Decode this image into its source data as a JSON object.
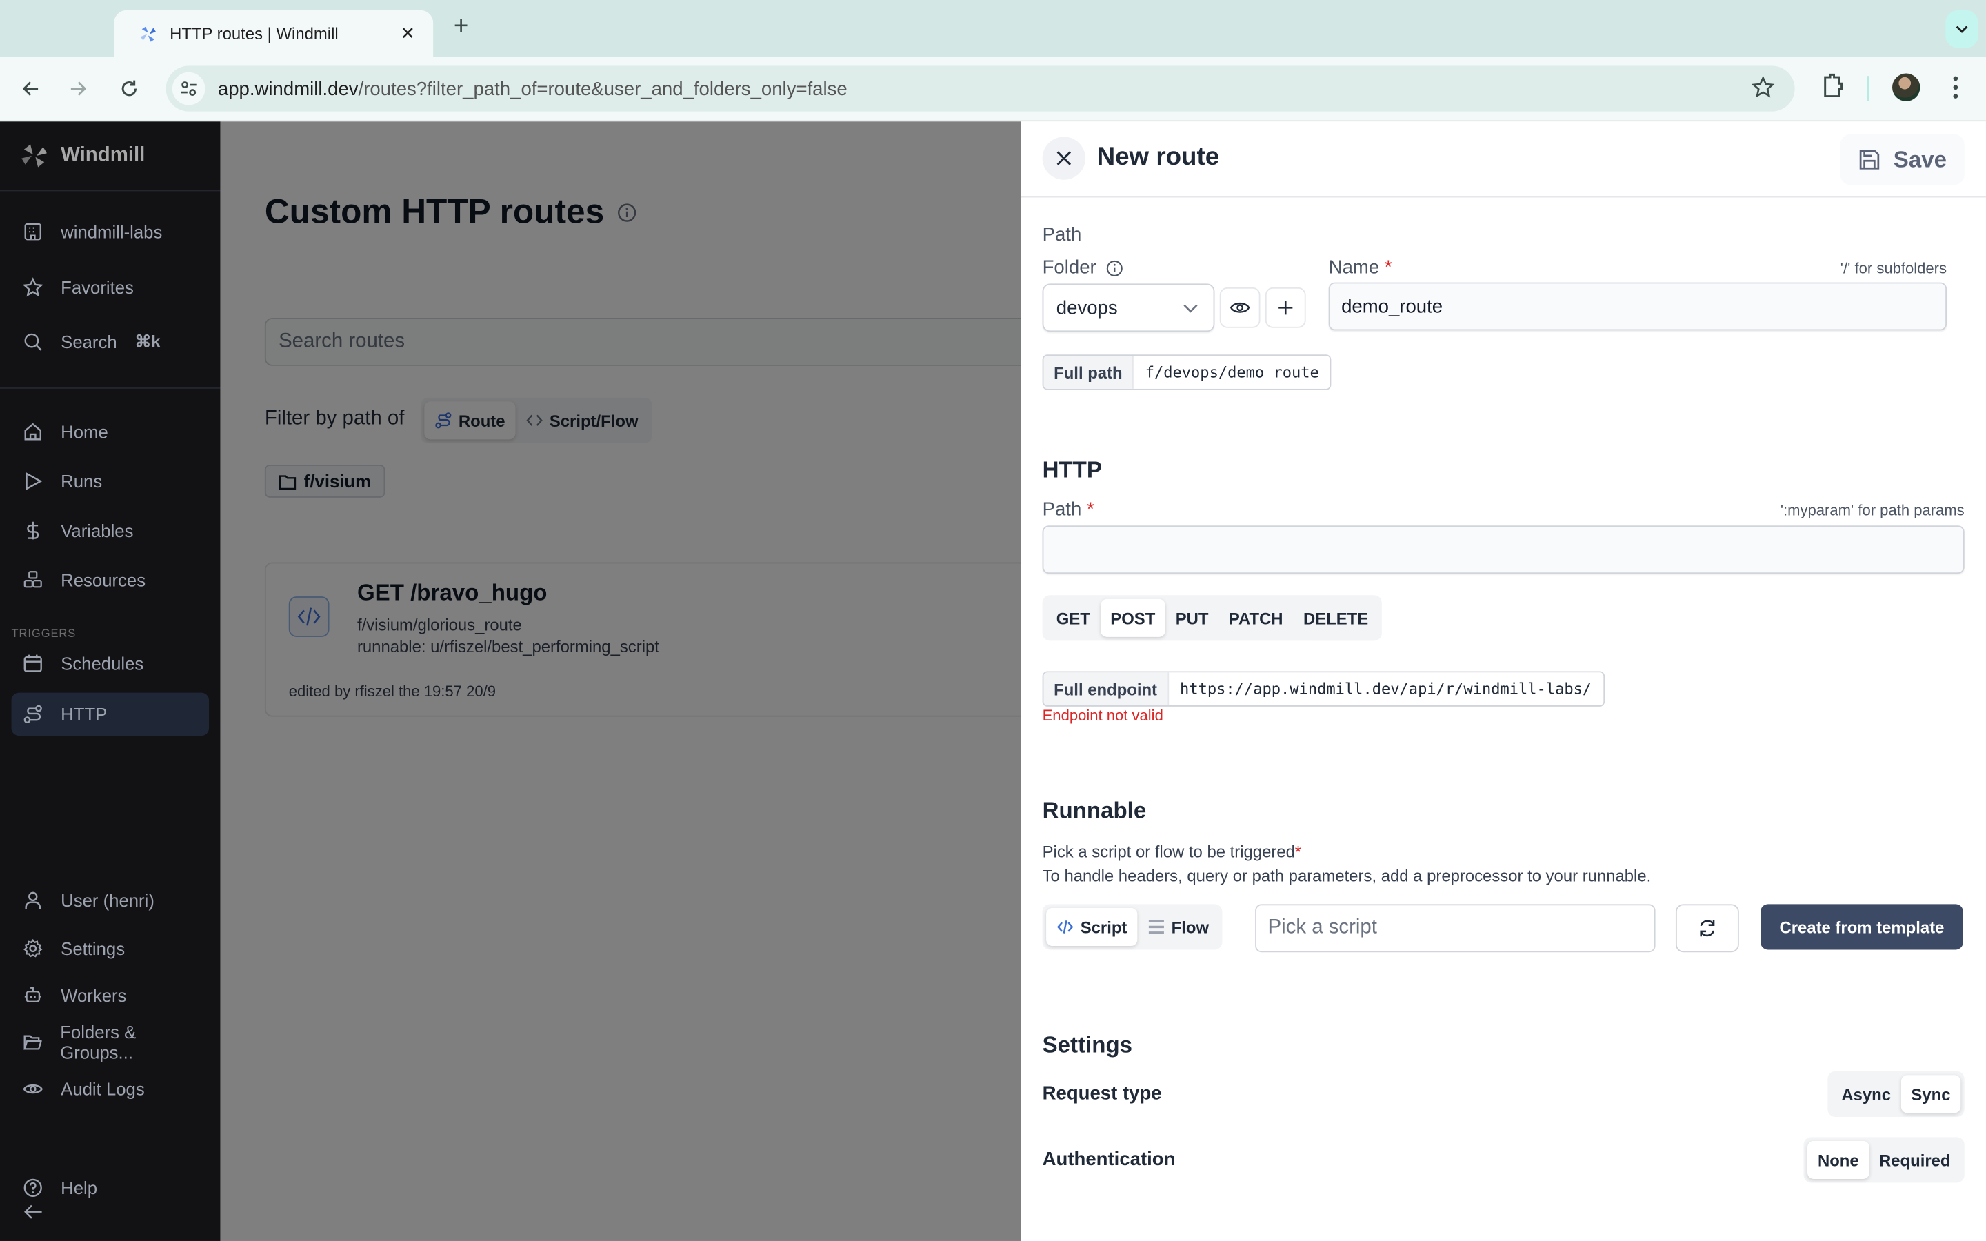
{
  "browser": {
    "tab_title": "HTTP routes | Windmill",
    "url_host": "app.windmill.dev",
    "url_rest": "/routes?filter_path_of=route&user_and_folders_only=false"
  },
  "sidebar": {
    "brand": "Windmill",
    "top_items": [
      {
        "label": "windmill-labs",
        "icon": "building-icon"
      },
      {
        "label": "Favorites",
        "icon": "star-icon"
      },
      {
        "label": "Search",
        "icon": "search-icon",
        "shortcut": "⌘k"
      }
    ],
    "main_items": [
      {
        "label": "Home",
        "icon": "home-icon"
      },
      {
        "label": "Runs",
        "icon": "play-icon"
      },
      {
        "label": "Variables",
        "icon": "dollar-icon"
      },
      {
        "label": "Resources",
        "icon": "boxes-icon"
      }
    ],
    "section_label": "TRIGGERS",
    "trigger_items": [
      {
        "label": "Schedules",
        "icon": "calendar-icon"
      },
      {
        "label": "HTTP",
        "icon": "route-icon",
        "active": true
      }
    ],
    "bottom_items": [
      {
        "label": "User (henri)",
        "icon": "user-icon"
      },
      {
        "label": "Settings",
        "icon": "gear-icon"
      },
      {
        "label": "Workers",
        "icon": "bot-icon"
      },
      {
        "label": "Folders & Groups...",
        "icon": "folder-open-icon"
      },
      {
        "label": "Audit Logs",
        "icon": "eye-icon"
      }
    ],
    "help_label": "Help"
  },
  "main": {
    "title": "Custom HTTP routes",
    "search_placeholder": "Search routes",
    "filter_label": "Filter by path of",
    "filter_options": [
      "Route",
      "Script/Flow"
    ],
    "filter_selected": "Route",
    "folder_chip": "f/visium",
    "routes": [
      {
        "title": "GET /bravo_hugo",
        "path": "f/visium/glorious_route",
        "runnable": "runnable: u/rfiszel/best_performing_script",
        "edited": "edited by rfiszel the 19:57 20/9"
      }
    ]
  },
  "drawer": {
    "title": "New route",
    "save_label": "Save",
    "path_section": "Path",
    "folder_label": "Folder",
    "folder_value": "devops",
    "name_label": "Name",
    "name_hint": "'/' for subfolders",
    "name_value": "demo_route",
    "full_path_label": "Full path",
    "full_path_value": "f/devops/demo_route",
    "http_section": "HTTP",
    "http_path_label": "Path",
    "http_path_hint": "':myparam' for path params",
    "http_path_value": "",
    "methods": [
      "GET",
      "POST",
      "PUT",
      "PATCH",
      "DELETE"
    ],
    "method_selected": "POST",
    "endpoint_label": "Full endpoint",
    "endpoint_value": "https://app.windmill.dev/api/r/windmill-labs/",
    "endpoint_error": "Endpoint not valid",
    "runnable_section": "Runnable",
    "runnable_desc1": "Pick a script or flow to be triggered",
    "runnable_desc2": "To handle headers, query or path parameters, add a preprocessor to your runnable.",
    "runnable_kinds": [
      "Script",
      "Flow"
    ],
    "runnable_kind_selected": "Script",
    "pick_placeholder": "Pick a script",
    "create_template_label": "Create from template",
    "settings_section": "Settings",
    "request_type_label": "Request type",
    "request_type_options": [
      "Async",
      "Sync"
    ],
    "request_type_selected": "Sync",
    "auth_label": "Authentication",
    "auth_options": [
      "None",
      "Required"
    ],
    "auth_selected": "None"
  }
}
